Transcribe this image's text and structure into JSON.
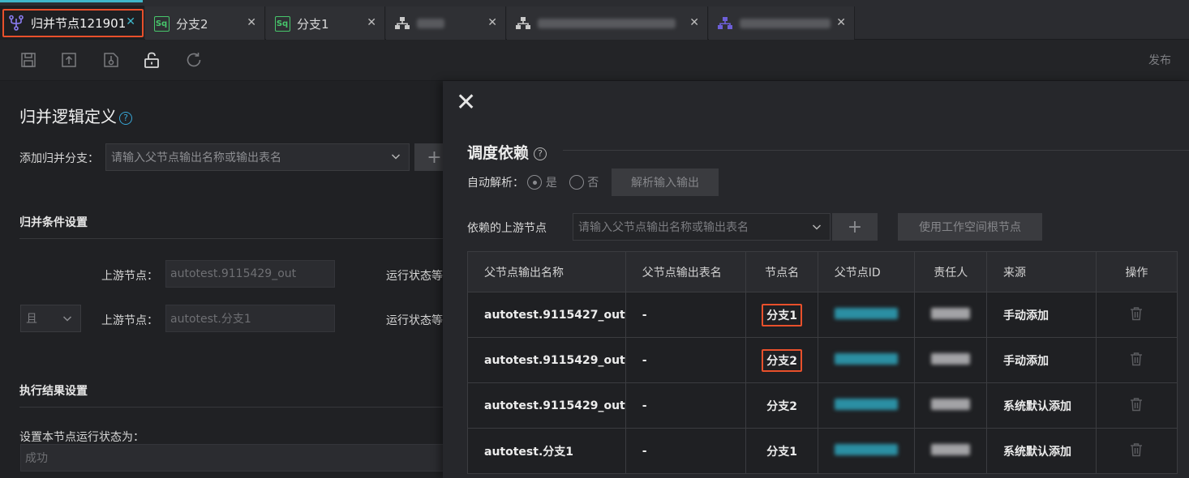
{
  "tabs": [
    {
      "label": "归并节点121901",
      "icon": "merge-node-icon",
      "active": true
    },
    {
      "label": "分支2",
      "icon": "sql-icon"
    },
    {
      "label": "分支1",
      "icon": "sql-icon"
    },
    {
      "label": "",
      "icon": "flow-icon"
    },
    {
      "label": "",
      "icon": "flow-icon"
    },
    {
      "label": "",
      "icon": "flow-icon"
    }
  ],
  "toolbar": {
    "publish_label": "发布"
  },
  "left": {
    "title": "归并逻辑定义",
    "add_branch_label": "添加归并分支：",
    "add_branch_placeholder": "请输入父节点输出名称或输出表名",
    "merge_condition_title": "归并条件设置",
    "rows": [
      {
        "upstream_label": "上游节点：",
        "upstream_value": "autotest.9115429_out",
        "status_label": "运行状态等"
      },
      {
        "logic": "且",
        "upstream_label": "上游节点：",
        "upstream_value": "autotest.分支1",
        "status_label": "运行状态等"
      }
    ],
    "exec_result_title": "执行结果设置",
    "set_status_label": "设置本节点运行状态为：",
    "status_value": "成功"
  },
  "drawer": {
    "title": "调度依赖",
    "auto_parse_label": "自动解析：",
    "yes_label": "是",
    "no_label": "否",
    "parse_button": "解析输入输出",
    "upstream_label": "依赖的上游节点",
    "upstream_placeholder": "请输入父节点输出名称或输出表名",
    "root_button": "使用工作空间根节点",
    "table": {
      "headers": [
        "父节点输出名称",
        "父节点输出表名",
        "节点名",
        "父节点ID",
        "责任人",
        "来源",
        "操作"
      ],
      "rows": [
        {
          "output": "autotest.9115427_out",
          "table": "-",
          "node": "分支1",
          "source": "手动添加",
          "highlight": true
        },
        {
          "output": "autotest.9115429_out",
          "table": "-",
          "node": "分支2",
          "source": "手动添加",
          "highlight": true
        },
        {
          "output": "autotest.9115429_out",
          "table": "-",
          "node": "分支2",
          "source": "系统默认添加",
          "highlight": false
        },
        {
          "output": "autotest.分支1",
          "table": "-",
          "node": "分支1",
          "source": "系统默认添加",
          "highlight": false
        }
      ]
    }
  },
  "colors": {
    "accent": "#3fb6c9",
    "highlight": "#e8502b",
    "sql": "#47c66b"
  }
}
